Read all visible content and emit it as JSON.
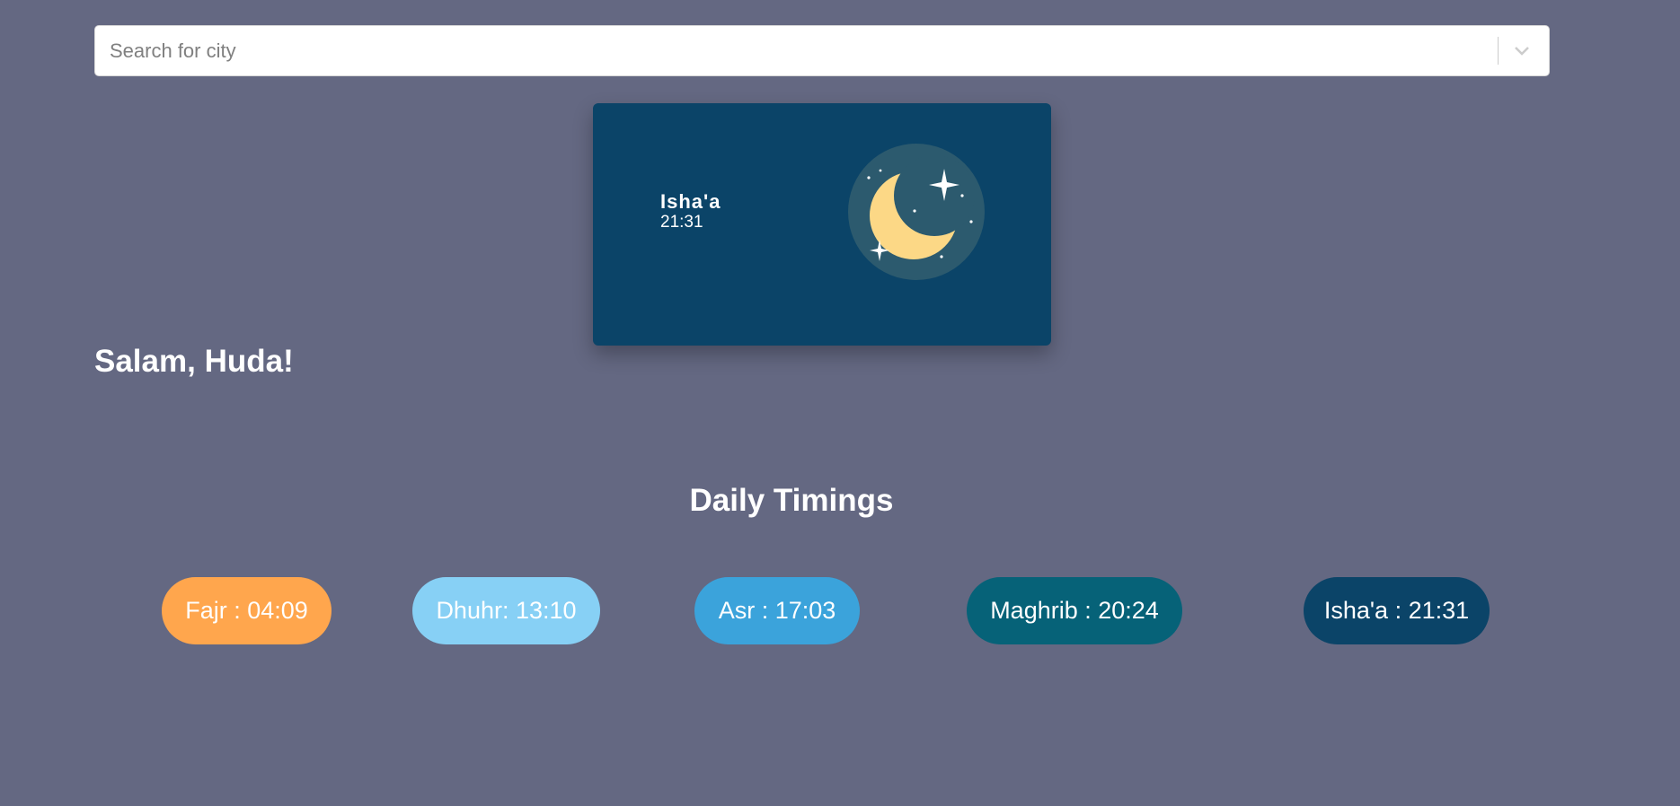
{
  "search": {
    "placeholder": "Search for city",
    "value": ""
  },
  "current_prayer": {
    "name": "Isha'a",
    "time": "21:31",
    "icon": "crescent-moon-stars-icon"
  },
  "greeting": "Salam, Huda!",
  "daily_timings": {
    "heading": "Daily Timings",
    "items": [
      {
        "label": "Fajr : 04:09",
        "color": "#ffa64d"
      },
      {
        "label": "Dhuhr: 13:10",
        "color": "#87d0f5"
      },
      {
        "label": "Asr : 17:03",
        "color": "#3ba3db"
      },
      {
        "label": "Maghrib : 20:24",
        "color": "#066278"
      },
      {
        "label": "Isha'a : 21:31",
        "color": "#0b4468"
      }
    ]
  },
  "colors": {
    "background": "#646882",
    "card": "#0b4468",
    "moon": "#fcd886",
    "moon_halo": "#2c5a6e"
  }
}
